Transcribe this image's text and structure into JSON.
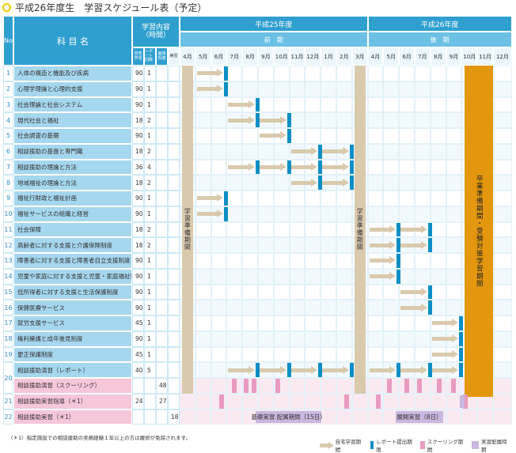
{
  "title": "平成26年度生　学習スケジュール表（予定）",
  "header": {
    "no": "No",
    "subject": "科 目 名",
    "content": "学習内容\n（時間）",
    "content_sub": [
      "自宅\n学習",
      "レポート\n回数",
      "面接\n授業",
      "実習"
    ],
    "year1": "平成25年度",
    "year2": "平成26年度",
    "term1": "前　期",
    "term2": "後　期",
    "months": [
      "4月",
      "5月",
      "6月",
      "7月",
      "8月",
      "9月",
      "10月",
      "11月",
      "12月",
      "1月",
      "2月",
      "3月",
      "4月",
      "5月",
      "6月",
      "7月",
      "8月",
      "9月",
      "10月",
      "11月",
      "12月"
    ]
  },
  "rows": [
    {
      "no": "1",
      "name": "人体の構造と機能及び疾病",
      "home": "90",
      "rep": "1",
      "face": "",
      "prac": ""
    },
    {
      "no": "2",
      "name": "心理学理論と心理的支援",
      "home": "90",
      "rep": "1",
      "face": "",
      "prac": ""
    },
    {
      "no": "3",
      "name": "社会理論と社会システム",
      "home": "90",
      "rep": "1",
      "face": "",
      "prac": ""
    },
    {
      "no": "4",
      "name": "現代社会と福祉",
      "home": "180",
      "rep": "2",
      "face": "",
      "prac": ""
    },
    {
      "no": "5",
      "name": "社会調査の基礎",
      "home": "90",
      "rep": "1",
      "face": "",
      "prac": ""
    },
    {
      "no": "6",
      "name": "相談援助の基盤と専門職",
      "home": "180",
      "rep": "2",
      "face": "",
      "prac": ""
    },
    {
      "no": "7",
      "name": "相談援助の理論と方法",
      "home": "360",
      "rep": "4",
      "face": "",
      "prac": ""
    },
    {
      "no": "8",
      "name": "地域福祉の理論と方法",
      "home": "180",
      "rep": "2",
      "face": "",
      "prac": ""
    },
    {
      "no": "9",
      "name": "福祉行財政と福祉計画",
      "home": "90",
      "rep": "1",
      "face": "",
      "prac": ""
    },
    {
      "no": "10",
      "name": "福祉サービスの組織と経営",
      "home": "90",
      "rep": "1",
      "face": "",
      "prac": ""
    },
    {
      "no": "11",
      "name": "社会保障",
      "home": "180",
      "rep": "2",
      "face": "",
      "prac": ""
    },
    {
      "no": "12",
      "name": "高齢者に対する支援と介護保険制度",
      "home": "180",
      "rep": "2",
      "face": "",
      "prac": ""
    },
    {
      "no": "13",
      "name": "障害者に対する支援と障害者自立支援制度",
      "home": "90",
      "rep": "1",
      "face": "",
      "prac": ""
    },
    {
      "no": "14",
      "name": "児童や家庭に対する支援と児童・家庭福祉制度",
      "home": "90",
      "rep": "1",
      "face": "",
      "prac": ""
    },
    {
      "no": "15",
      "name": "低所得者に対する支援と生活保護制度",
      "home": "90",
      "rep": "1",
      "face": "",
      "prac": ""
    },
    {
      "no": "16",
      "name": "保健医療サービス",
      "home": "90",
      "rep": "1",
      "face": "",
      "prac": ""
    },
    {
      "no": "17",
      "name": "就労支援サービス",
      "home": "45",
      "rep": "1",
      "face": "",
      "prac": ""
    },
    {
      "no": "18",
      "name": "権利擁護と成年後見制度",
      "home": "90",
      "rep": "1",
      "face": "",
      "prac": ""
    },
    {
      "no": "19",
      "name": "更正保護制度",
      "home": "45",
      "rep": "1",
      "face": "",
      "prac": ""
    },
    {
      "no": "20",
      "name": "相談援助演習（レポート）",
      "home": "405",
      "rep": "5",
      "face": "",
      "prac": ""
    },
    {
      "no": "",
      "name": "相談援助演習（スクーリング）",
      "home": "",
      "rep": "",
      "face": "48",
      "prac": ""
    },
    {
      "no": "21",
      "name": "相談援助実習指導（＊1）",
      "home": "243",
      "rep": "",
      "face": "27",
      "prac": ""
    },
    {
      "no": "22",
      "name": "相談援助実習（＊1）",
      "home": "",
      "rep": "",
      "face": "",
      "prac": "180"
    }
  ],
  "prep_label": "学習準備期間",
  "grad_label": "卒業準備期間・受験対策学習期間",
  "practice1": "基礎実習 配属期間（15日）",
  "practice2": "展開実習（8日）",
  "note": "（＊1）指定施設での相談援助の実務経験１年以上の方は履修が免除されます。",
  "legend": [
    "自宅学習期間",
    "レポート提出期限",
    "スクーリング期間",
    "実習配属時期"
  ],
  "colors": {
    "header": "#2f9fcf",
    "arrow": "#d9c9ad",
    "report": "#0c8ec6",
    "school": "#e99bbf",
    "practice": "#c9b7df",
    "grad": "#e3970f"
  }
}
